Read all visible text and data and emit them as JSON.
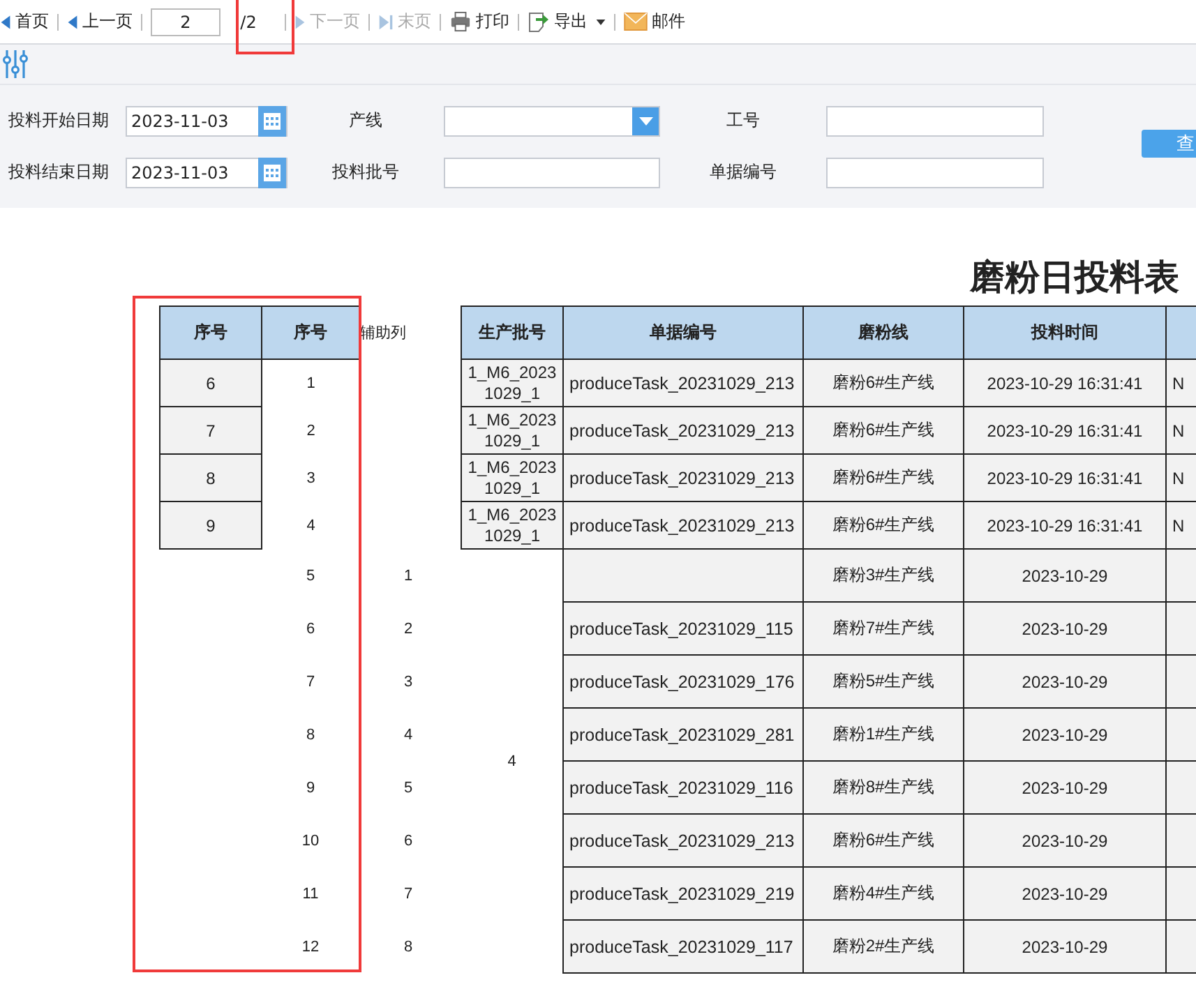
{
  "toolbar": {
    "items": [
      {
        "kind": "first",
        "label": "首页",
        "disabled": false
      },
      {
        "kind": "prev",
        "label": "上一页",
        "disabled": false
      },
      {
        "kind": "page",
        "value": "2",
        "total": "/2"
      },
      {
        "kind": "next",
        "label": "下一页",
        "disabled": true
      },
      {
        "kind": "last",
        "label": "末页",
        "disabled": true
      },
      {
        "kind": "print",
        "label": "打印",
        "disabled": false
      },
      {
        "kind": "export",
        "label": "导出",
        "disabled": false
      },
      {
        "kind": "mail",
        "label": "邮件",
        "disabled": false
      }
    ]
  },
  "filter": {
    "fields": [
      {
        "kind": "date",
        "label": "投料开始日期",
        "value": "2023-11-03"
      },
      {
        "kind": "select",
        "label": "产线"
      },
      {
        "kind": "text",
        "label": "工号"
      },
      {
        "kind": "date",
        "label": "投料结束日期",
        "value": "2023-11-03"
      },
      {
        "kind": "text",
        "label": "投料批号"
      },
      {
        "kind": "text",
        "label": "单据编号"
      }
    ],
    "query_button": "查"
  },
  "report": {
    "title": "磨粉日投料表",
    "columns": [
      "序号",
      "序号",
      "辅助列",
      "生产批号",
      "单据编号",
      "磨粉线",
      "投料时间"
    ],
    "merged_batch": "4",
    "rows": [
      {
        "seq_a": "6",
        "seq_b": "1",
        "batch": "1_M6_2023 1029_1",
        "doc_no": "produceTask_20231029_213",
        "line": "磨粉6#生产线",
        "time": "2023-10-29 16:31:41",
        "column_8": "N"
      },
      {
        "seq_a": "7",
        "seq_b": "2",
        "batch": "1_M6_2023 1029_1",
        "doc_no": "produceTask_20231029_213",
        "line": "磨粉6#生产线",
        "time": "2023-10-29 16:31:41",
        "column_8": "N"
      },
      {
        "seq_a": "8",
        "seq_b": "3",
        "batch": "1_M6_2023 1029_1",
        "doc_no": "produceTask_20231029_213",
        "line": "磨粉6#生产线",
        "time": "2023-10-29 16:31:41",
        "column_8": "N"
      },
      {
        "seq_a": "9",
        "seq_b": "4",
        "batch": "1_M6_2023 1029_1",
        "doc_no": "produceTask_20231029_213",
        "line": "磨粉6#生产线",
        "time": "2023-10-29 16:31:41",
        "column_8": "N"
      },
      {
        "seq_b": "5",
        "aux": "1",
        "line": "磨粉3#生产线",
        "time": "2023-10-29"
      },
      {
        "seq_b": "6",
        "aux": "2",
        "doc_no": "produceTask_20231029_115",
        "line": "磨粉7#生产线",
        "time": "2023-10-29"
      },
      {
        "seq_b": "7",
        "aux": "3",
        "doc_no": "produceTask_20231029_176",
        "line": "磨粉5#生产线",
        "time": "2023-10-29"
      },
      {
        "seq_b": "8",
        "aux": "4",
        "doc_no": "produceTask_20231029_281",
        "line": "磨粉1#生产线",
        "time": "2023-10-29"
      },
      {
        "seq_b": "9",
        "aux": "5",
        "doc_no": "produceTask_20231029_116",
        "line": "磨粉8#生产线",
        "time": "2023-10-29"
      },
      {
        "seq_b": "10",
        "aux": "6",
        "doc_no": "produceTask_20231029_213",
        "line": "磨粉6#生产线",
        "time": "2023-10-29"
      },
      {
        "seq_b": "11",
        "aux": "7",
        "doc_no": "produceTask_20231029_219",
        "line": "磨粉4#生产线",
        "time": "2023-10-29"
      },
      {
        "seq_b": "12",
        "aux": "8",
        "doc_no": "produceTask_20231029_117",
        "line": "磨粉2#生产线",
        "time": "2023-10-29"
      }
    ]
  }
}
